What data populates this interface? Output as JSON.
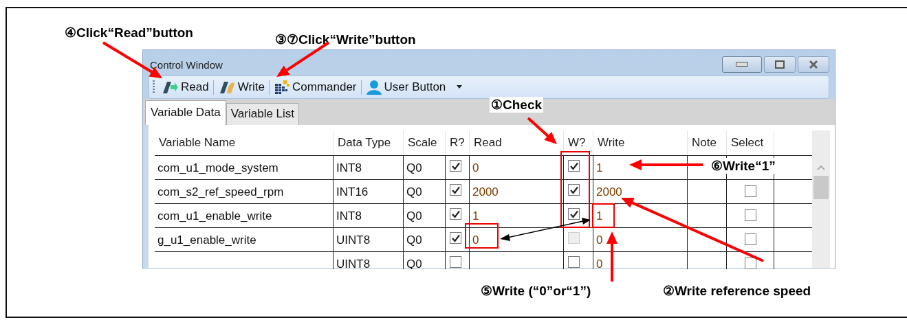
{
  "annotations": [
    {
      "text": "④Click“Read”button"
    },
    {
      "text": "③⑦Click“Write”button"
    },
    {
      "text": "①Check"
    },
    {
      "text": "⑥Write“1”"
    },
    {
      "text": "⑤Write (“0”or“1”)"
    },
    {
      "text": "②Write reference speed"
    }
  ],
  "window": {
    "title": "Control Window"
  },
  "toolbar": [
    {
      "label": "Read",
      "kind": "read"
    },
    {
      "label": "Write",
      "kind": "write"
    },
    {
      "label": "Commander",
      "kind": "commander"
    },
    {
      "label": "User Button",
      "kind": "user",
      "dropdown": true
    }
  ],
  "tabs": [
    {
      "label": "Variable Data",
      "selected": true
    },
    {
      "label": "Variable List",
      "selected": false
    }
  ],
  "table": {
    "columns": [
      "Variable Name",
      "Data Type",
      "Scale",
      "R?",
      "Read",
      "W?",
      "Write",
      "Note",
      "Select"
    ],
    "rows": [
      {
        "name": "com_u1_mode_system",
        "type": "INT8",
        "scale": "Q0",
        "r_checked": true,
        "read": "0",
        "w_checked": true,
        "w_disabled": false,
        "write": "1"
      },
      {
        "name": "com_s2_ref_speed_rpm",
        "type": "INT16",
        "scale": "Q0",
        "r_checked": true,
        "read": "2000",
        "w_checked": true,
        "w_disabled": false,
        "write": "2000",
        "select_checked": false
      },
      {
        "name": "com_u1_enable_write",
        "type": "INT8",
        "scale": "Q0",
        "r_checked": true,
        "read": "1",
        "w_checked": true,
        "w_disabled": false,
        "write": "1",
        "select_checked": false
      },
      {
        "name": "g_u1_enable_write",
        "type": "UINT8",
        "scale": "Q0",
        "r_checked": true,
        "read": "0",
        "w_checked": false,
        "w_disabled": true,
        "write": "0",
        "select_checked": false
      },
      {
        "type": "UINT8",
        "scale": "Q0",
        "r_checked": false,
        "w_checked": false,
        "w_disabled": false,
        "write": "0",
        "select_checked": false
      }
    ]
  }
}
